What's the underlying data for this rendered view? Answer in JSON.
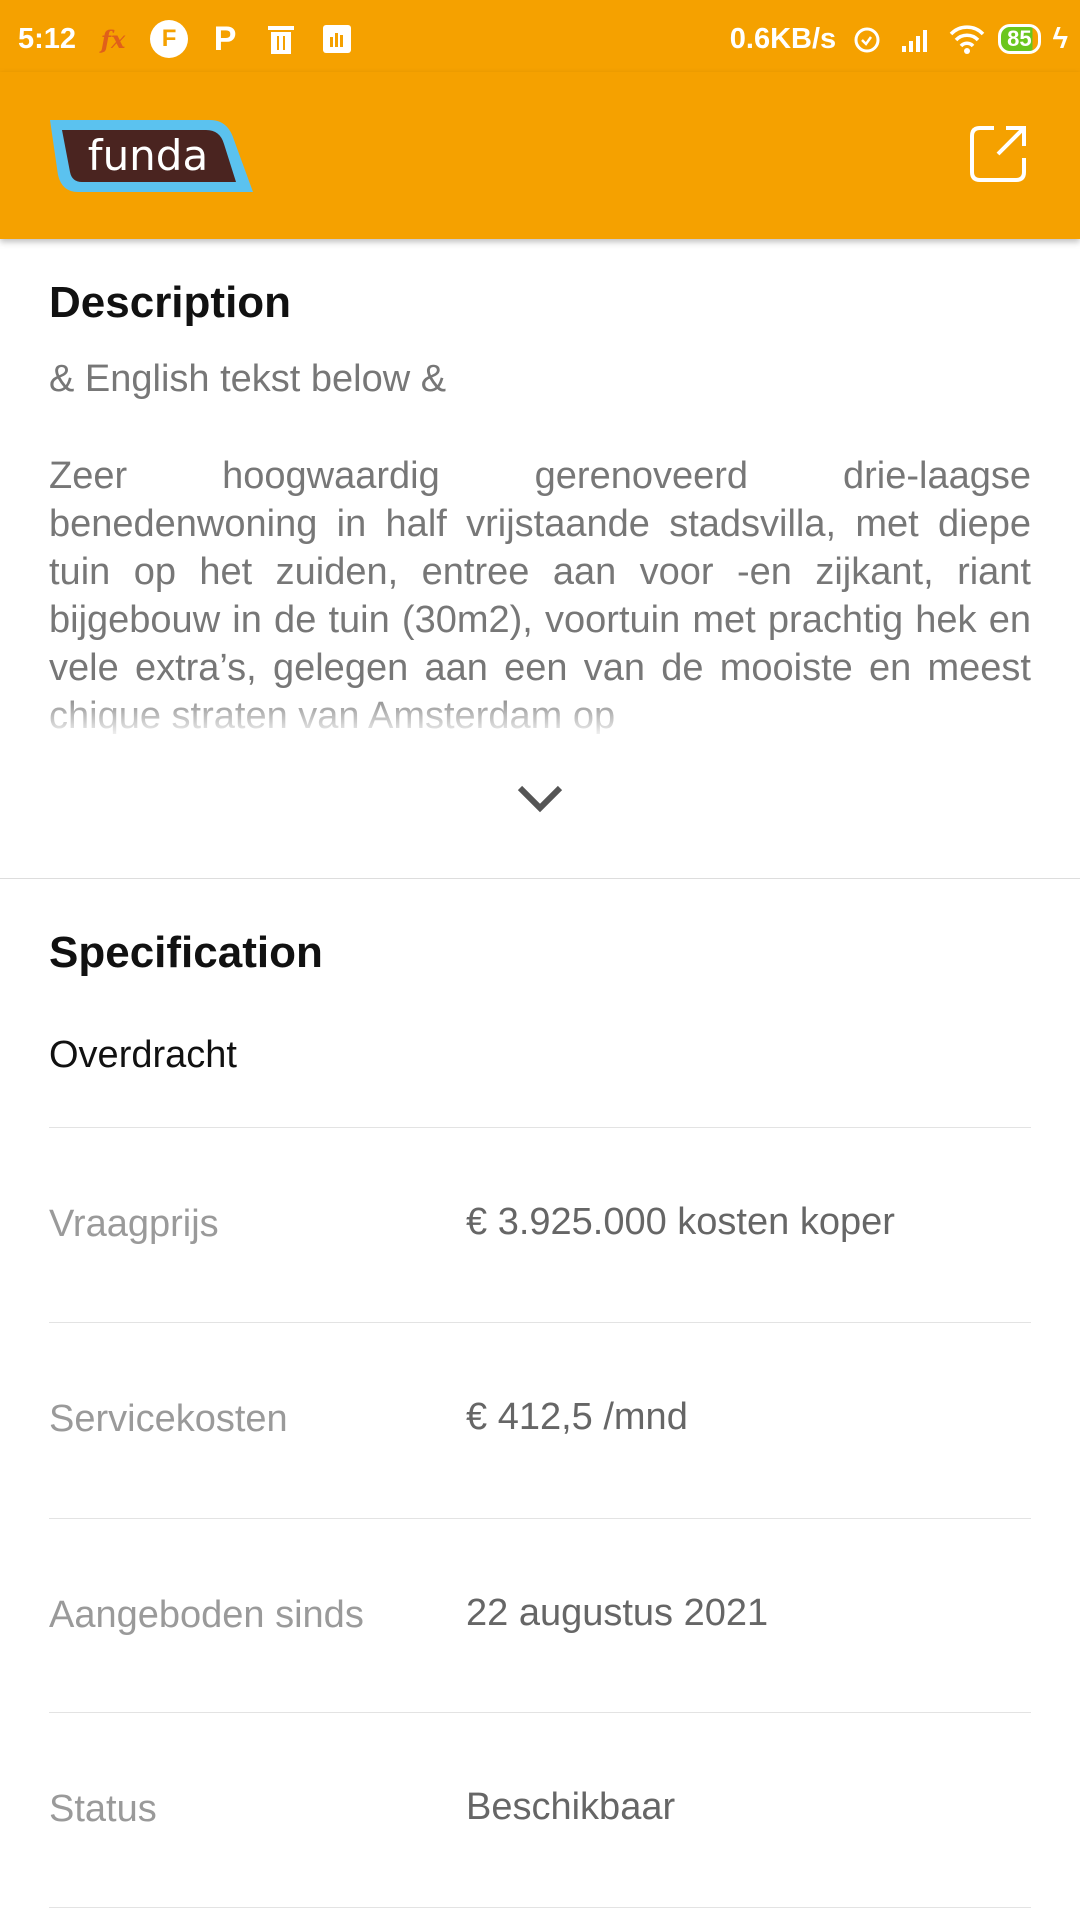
{
  "status_bar": {
    "time": "5:12",
    "net_speed": "0.6KB/s",
    "battery": "85",
    "icons": [
      "fx-icon",
      "f-app-icon",
      "p-app-icon",
      "trash-icon",
      "chart-app-icon",
      "alarm-icon",
      "signal-icon",
      "wifi-icon",
      "battery-icon",
      "charging-icon"
    ]
  },
  "header": {
    "logo": "funda",
    "share_icon": "open-external-icon"
  },
  "description": {
    "title": "Description",
    "intro": "& English tekst below &",
    "text": "Zeer hoogwaardig gerenoveerd drie-laagse benedenwoning in half vrijstaande stadsvilla, met diepe tuin op het zuiden, entree aan voor -en zijkant, riant bijgebouw in de tuin (30m2), voortuin met prachtig hek en vele extra’s, gelegen aan een van de mooiste en meest chique straten van Amsterdam op"
  },
  "specification": {
    "title": "Specification",
    "subtitle": "Overdracht",
    "rows": [
      {
        "label": "Vraagprijs",
        "value": "€ 3.925.000 kosten koper"
      },
      {
        "label": "Servicekosten",
        "value": "€ 412,5 /mnd"
      },
      {
        "label": "Aangeboden sinds",
        "value": "22 augustus 2021"
      },
      {
        "label": "Status",
        "value": "Beschikbaar"
      }
    ]
  },
  "colors": {
    "brand": "#f5a100",
    "logo_bg": "#4a2420",
    "logo_border": "#5bc2ef"
  }
}
